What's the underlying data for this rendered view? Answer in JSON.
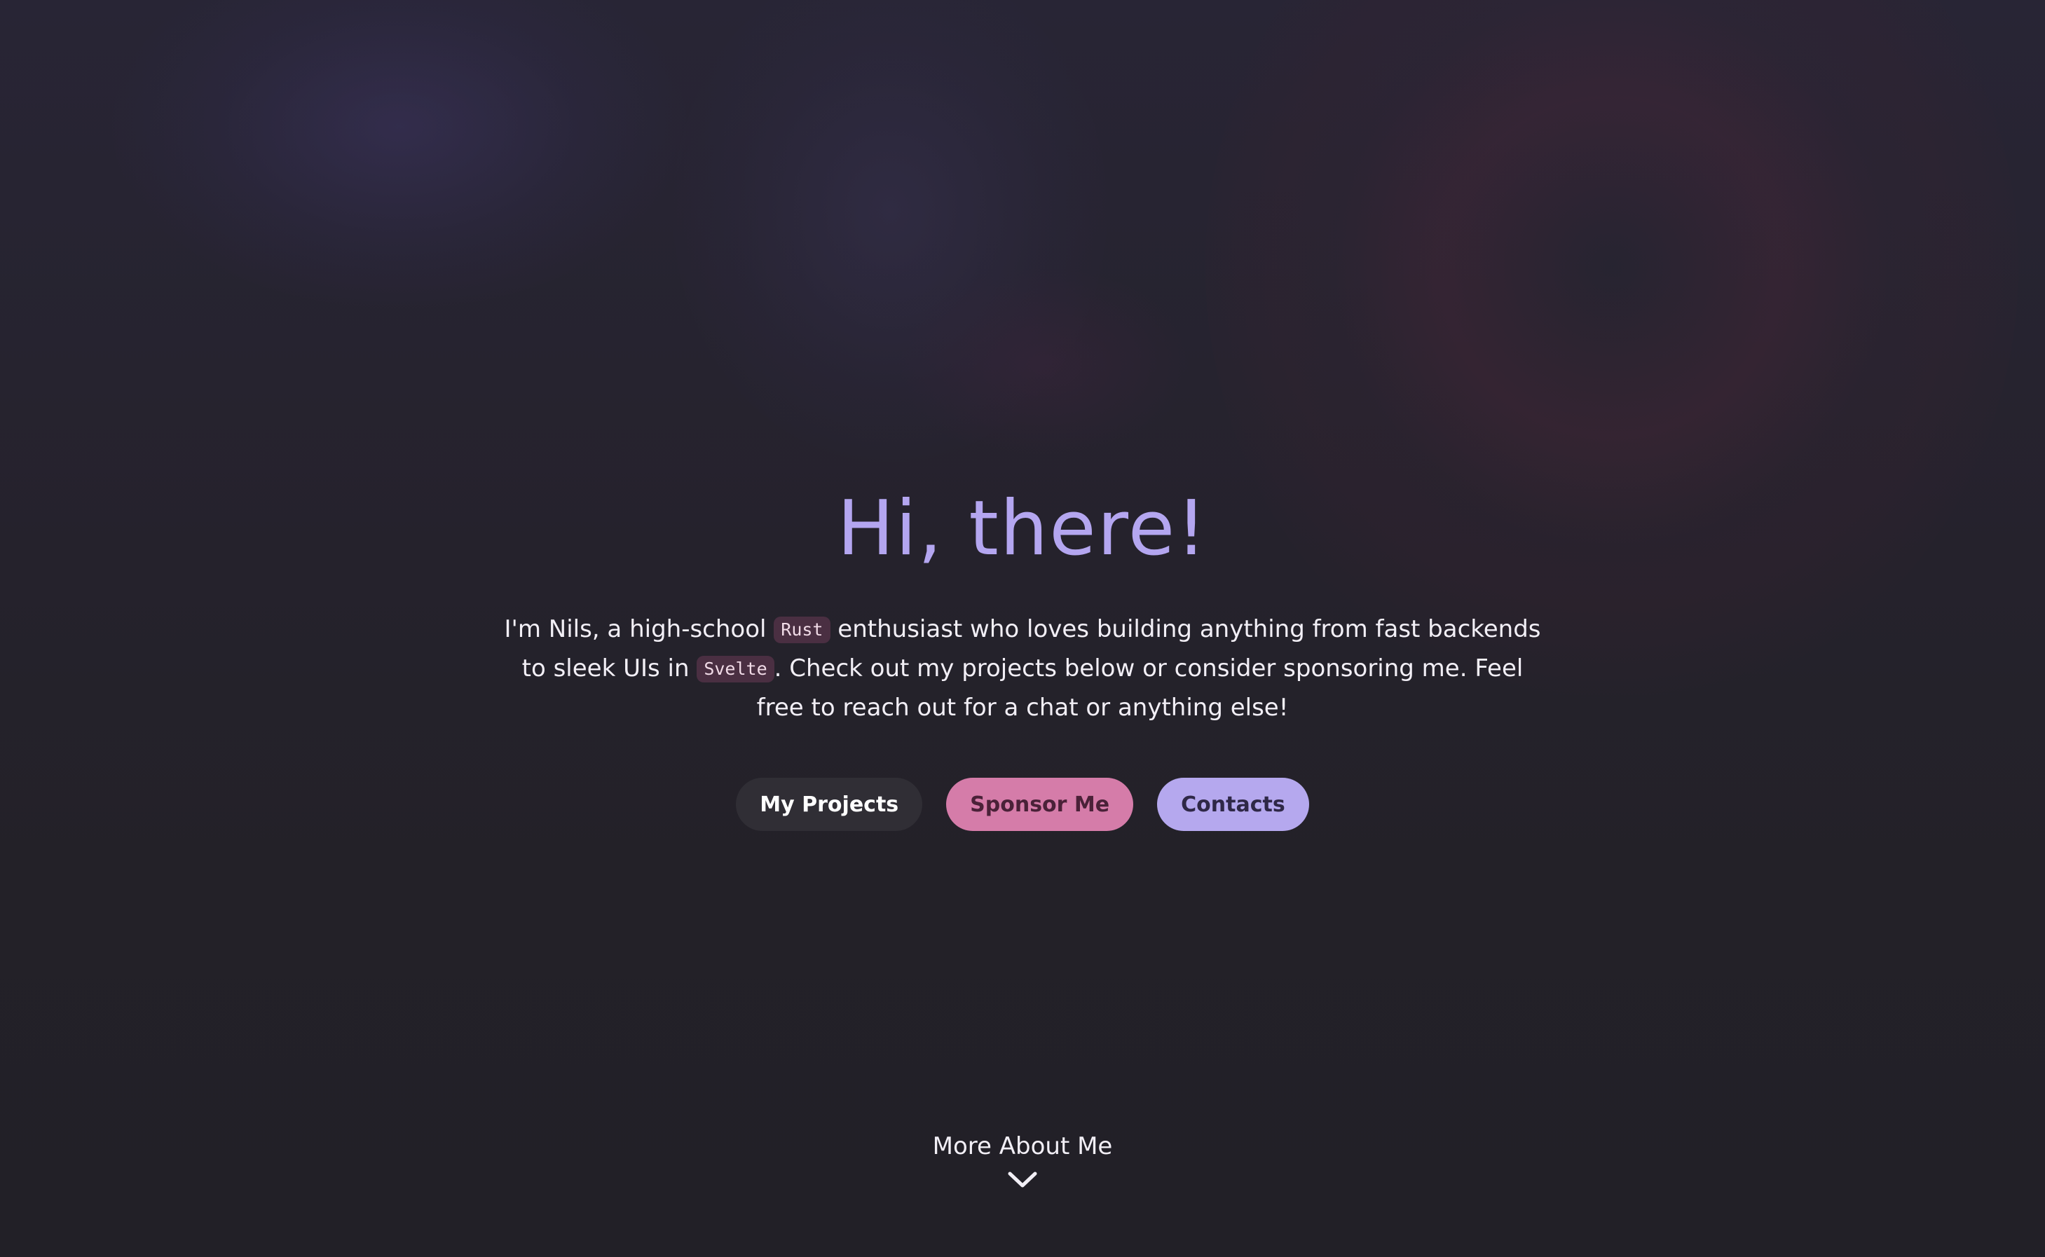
{
  "hero": {
    "title": "Hi, there!",
    "intro": {
      "part1": "I'm Nils, a high-school ",
      "code1": "Rust",
      "part2": " enthusiast who loves building anything from fast backends to sleek UIs in ",
      "code2": "Svelte",
      "part3": ". Check out my projects below or consider sponsoring me. Feel free to reach out for a chat or anything else!"
    }
  },
  "buttons": {
    "projects": "My Projects",
    "sponsor": "Sponsor Me",
    "contacts": "Contacts"
  },
  "more": {
    "label": "More About Me",
    "icon": "chevron-down-icon"
  },
  "colors": {
    "background": "#232128",
    "title": "#b4a6f0",
    "text": "#f2eff6",
    "code_chip_bg": "#4a2f42",
    "projects_button": "#302e35",
    "sponsor_button": "#d57ca9",
    "contacts_button": "#b5a8ee"
  }
}
